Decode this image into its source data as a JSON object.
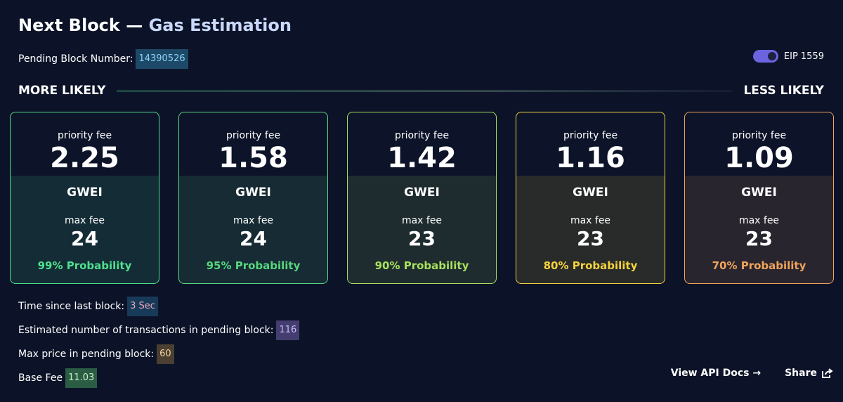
{
  "header": {
    "title_main": "Next Block — ",
    "title_accent": "Gas Estimation"
  },
  "pending": {
    "label": "Pending Block Number:",
    "value": "14390526"
  },
  "eip": {
    "label": "EIP 1559",
    "enabled": true
  },
  "likelihood": {
    "left_label": "MORE LIKELY",
    "right_label": "LESS LIKELY"
  },
  "cards": [
    {
      "priority_label": "priority fee",
      "priority_value": "2.25",
      "unit": "GWEI",
      "max_label": "max fee",
      "max_value": "24",
      "probability": "99% Probability",
      "color": "#4ee08f"
    },
    {
      "priority_label": "priority fee",
      "priority_value": "1.58",
      "unit": "GWEI",
      "max_label": "max fee",
      "max_value": "24",
      "probability": "95% Probability",
      "color": "#57d77e"
    },
    {
      "priority_label": "priority fee",
      "priority_value": "1.42",
      "unit": "GWEI",
      "max_label": "max fee",
      "max_value": "23",
      "probability": "90% Probability",
      "color": "#a8e05e"
    },
    {
      "priority_label": "priority fee",
      "priority_value": "1.16",
      "unit": "GWEI",
      "max_label": "max fee",
      "max_value": "23",
      "probability": "80% Probability",
      "color": "#f4d33c"
    },
    {
      "priority_label": "priority fee",
      "priority_value": "1.09",
      "unit": "GWEI",
      "max_label": "max fee",
      "max_value": "23",
      "probability": "70% Probability",
      "color": "#f2a45b"
    }
  ],
  "stats": {
    "time_label": "Time since last block:",
    "time_value": "3 Sec",
    "tx_label": "Estimated number of transactions in pending block:",
    "tx_value": "116",
    "max_price_label": "Max price in pending block:",
    "max_price_value": "60",
    "base_fee_label": "Base Fee",
    "base_fee_value": "11.03"
  },
  "footer": {
    "api_docs": "View API Docs →",
    "share": "Share"
  },
  "icons": {
    "share": "share-icon"
  }
}
